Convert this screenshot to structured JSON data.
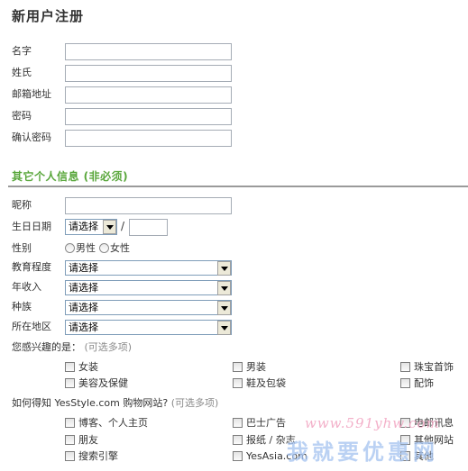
{
  "page_title": "新用户注册",
  "basic_fields": [
    {
      "label": "名字",
      "value": ""
    },
    {
      "label": "姓氏",
      "value": ""
    },
    {
      "label": "邮箱地址",
      "value": ""
    },
    {
      "label": "密码",
      "value": ""
    },
    {
      "label": "确认密码",
      "value": ""
    }
  ],
  "optional_section_title": "其它个人信息 (非必须)",
  "nickname": {
    "label": "昵称",
    "value": ""
  },
  "birthday": {
    "label": "生日日期",
    "month_selected": "请选择",
    "separator": "/",
    "day_value": ""
  },
  "gender": {
    "label": "性别",
    "options": [
      "男性",
      "女性"
    ]
  },
  "selects": [
    {
      "label": "教育程度",
      "selected": "请选择"
    },
    {
      "label": "年收入",
      "selected": "请选择"
    },
    {
      "label": "种族",
      "selected": "请选择"
    },
    {
      "label": "所在地区",
      "selected": "请选择"
    }
  ],
  "interests": {
    "question": "您感兴趣的是：",
    "hint": "(可选多项)",
    "options": [
      "女装",
      "男装",
      "珠宝首饰",
      "美容及保健",
      "鞋及包袋",
      "配饰"
    ]
  },
  "source": {
    "question": "如何得知 YesStyle.com 购物网站?",
    "hint": "(可选多项)",
    "options": [
      "博客、个人主页",
      "巴士广告",
      "电邮讯息",
      "朋友",
      "报纸 / 杂志",
      "其他网站",
      "搜索引擎",
      "YesAsia.com",
      "其他"
    ]
  },
  "watermark": {
    "line1": "www.591yhw.com",
    "line2": "我就要优惠网"
  },
  "colors": {
    "section_title": "#58a63a",
    "input_border": "#a5acb5",
    "select_border": "#7f9db9"
  }
}
